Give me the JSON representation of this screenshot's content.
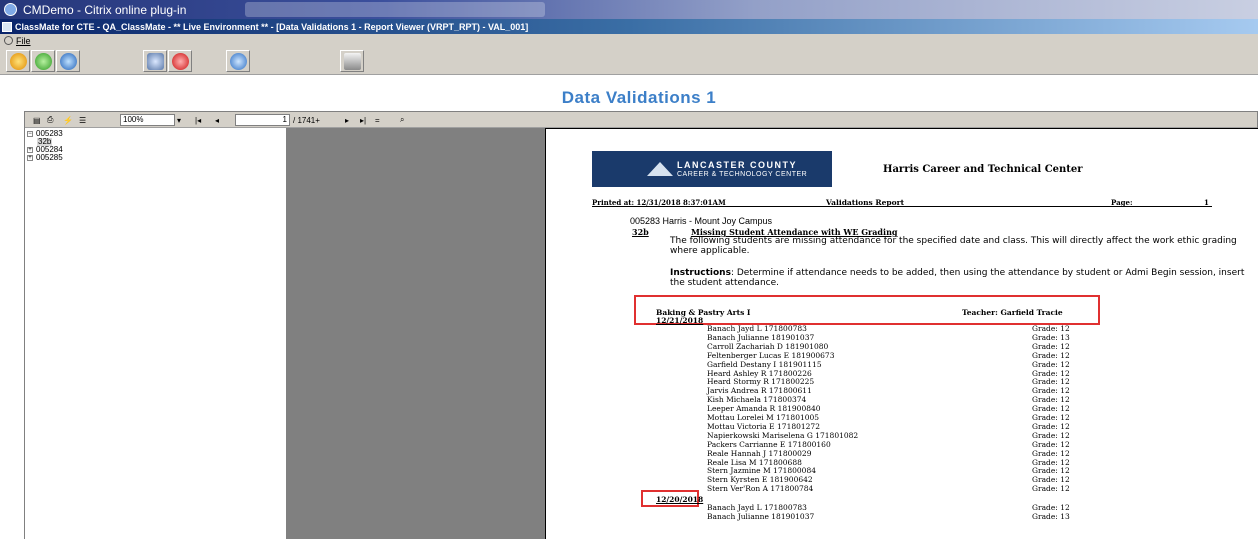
{
  "citrix": {
    "title": "CMDemo - Citrix online plug-in"
  },
  "app": {
    "title": "ClassMate for CTE - QA_ClassMate - ** Live Environment ** - [Data Validations 1 - Report Viewer (VRPT_RPT) - VAL_001]"
  },
  "menu": {
    "file": "File"
  },
  "page_title": "Data Validations 1",
  "viewer_toolbar": {
    "zoom": "100%",
    "page_current": "1",
    "page_total": "/ 1741+"
  },
  "tree": {
    "nodes": [
      {
        "label": "005283",
        "expander": "−",
        "children": [
          "32b"
        ]
      },
      {
        "label": "005284",
        "expander": "+"
      },
      {
        "label": "005285",
        "expander": "+"
      }
    ]
  },
  "report": {
    "logo_line1": "LANCASTER COUNTY",
    "logo_line2": "CAREER & TECHNOLOGY CENTER",
    "org_name": "Harris Career and Technical Center",
    "printed_at": "Printed at: 12/31/2018 8:37:01AM",
    "title": "Validations Report",
    "page_label": "Page:",
    "page_number": "1",
    "campus": "005283 Harris - Mount Joy Campus",
    "validation_code": "32b",
    "validation_title": "Missing Student Attendance with WE Grading",
    "description": "The following students are missing attendance for the specified date and class. This will directly affect the work ethic grading where applicable.",
    "instructions_label": "Instructions",
    "instructions_text": ": Determine if attendance needs to be added, then using the attendance by student or Admi Begin session, insert the student attendance.",
    "class_name": "Baking & Pastry Arts I",
    "teacher": "Teacher: Garfield Tracie",
    "groups": [
      {
        "date": "12/21/2018",
        "students": [
          {
            "name": "Banach Jayd L 171800783",
            "grade": "Grade: 12"
          },
          {
            "name": "Banach Julianne 181901037",
            "grade": "Grade: 13"
          },
          {
            "name": "Carroll Zachariah D 181901080",
            "grade": "Grade: 12"
          },
          {
            "name": "Feltenberger Lucas E 181900673",
            "grade": "Grade: 12"
          },
          {
            "name": "Garfield Destany I 181901115",
            "grade": "Grade: 12"
          },
          {
            "name": "Heard Ashley R 171800226",
            "grade": "Grade: 12"
          },
          {
            "name": "Heard Stormy R 171800225",
            "grade": "Grade: 12"
          },
          {
            "name": "Jarvis Andrea R 171800611",
            "grade": "Grade: 12"
          },
          {
            "name": "Kish Michaela 171800374",
            "grade": "Grade: 12"
          },
          {
            "name": "Leeper Amanda R 181900840",
            "grade": "Grade: 12"
          },
          {
            "name": "Mottau Lorelei M 171801005",
            "grade": "Grade: 12"
          },
          {
            "name": "Mottau Victoria E 171801272",
            "grade": "Grade: 12"
          },
          {
            "name": "Napierkowski Mariselena G 171801082",
            "grade": "Grade: 12"
          },
          {
            "name": "Packers Carrianne E 171800160",
            "grade": "Grade: 12"
          },
          {
            "name": "Reale Hannah J 171800029",
            "grade": "Grade: 12"
          },
          {
            "name": "Reale Lisa M 171800688",
            "grade": "Grade: 12"
          },
          {
            "name": "Stern Jazmine M 171800084",
            "grade": "Grade: 12"
          },
          {
            "name": "Stern Kyrsten E 181900642",
            "grade": "Grade: 12"
          },
          {
            "name": "Stern Ver'Ron A 171800784",
            "grade": "Grade: 12"
          }
        ]
      },
      {
        "date": "12/20/2018",
        "students": [
          {
            "name": "Banach Jayd L 171800783",
            "grade": "Grade: 12"
          },
          {
            "name": "Banach Julianne 181901037",
            "grade": "Grade: 13"
          }
        ]
      }
    ]
  },
  "colors": {
    "title_blue": "#3c7fc8",
    "highlight_red": "#e03030",
    "logo_navy": "#1a3a6b"
  }
}
